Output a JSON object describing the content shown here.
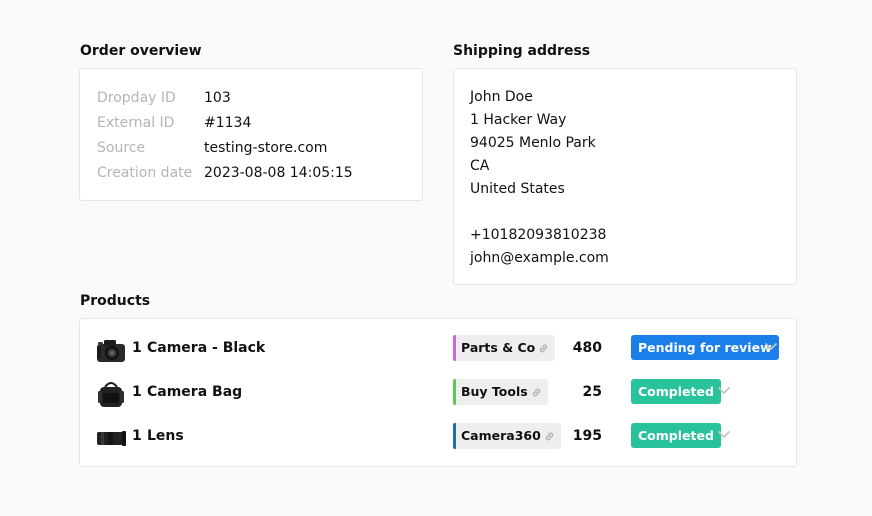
{
  "order_overview": {
    "title": "Order overview",
    "rows": [
      {
        "label": "Dropday ID",
        "value": "103"
      },
      {
        "label": "External ID",
        "value": "#1134"
      },
      {
        "label": "Source",
        "value": "testing-store.com"
      },
      {
        "label": "Creation date",
        "value": "2023-08-08 14:05:15"
      }
    ]
  },
  "shipping": {
    "title": "Shipping address",
    "name": "John Doe",
    "street": "1 Hacker Way",
    "city_line": "94025 Menlo Park",
    "state": "CA",
    "country": "United States",
    "phone": "+10182093810238",
    "email": "john@example.com"
  },
  "products": {
    "title": "Products",
    "items": [
      {
        "qty": "1",
        "name": "Camera - Black",
        "supplier": "Parts & Co",
        "supplier_color": "#c86dd7",
        "price": "480",
        "status": "Pending for review",
        "status_color": "#1a7fe8",
        "image_icon": "camera-icon"
      },
      {
        "qty": "1",
        "name": "Camera Bag",
        "supplier": "Buy Tools",
        "supplier_color": "#5cc75c",
        "price": "25",
        "status": "Completed",
        "status_color": "#28c39a",
        "image_icon": "camera-bag-icon"
      },
      {
        "qty": "1",
        "name": "Lens",
        "supplier": "Camera360",
        "supplier_color": "#1f6fa8",
        "price": "195",
        "status": "Completed",
        "status_color": "#28c39a",
        "image_icon": "lens-icon"
      }
    ]
  }
}
